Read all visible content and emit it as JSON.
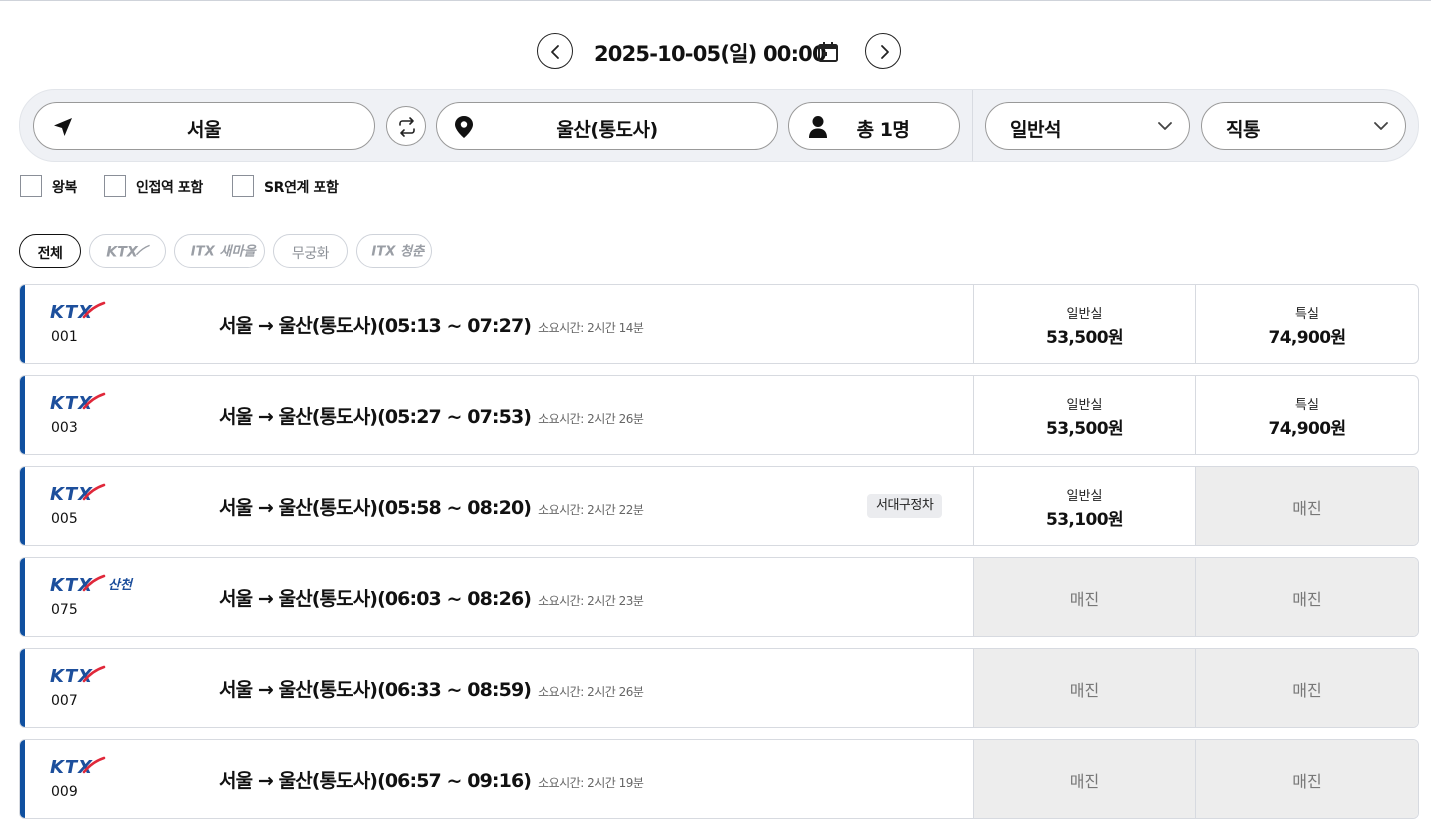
{
  "date_bar": {
    "date_text": "2025-10-05(일) 00:00"
  },
  "search": {
    "departure": "서울",
    "arrival": "울산(통도사)",
    "passengers": "총 1명",
    "seat_class": "일반석",
    "route_type": "직통"
  },
  "options": {
    "round_trip": "왕복",
    "include_nearby": "인접역 포함",
    "include_sr": "SR연계 포함"
  },
  "filters": {
    "all": "전체",
    "ktx": "KTX",
    "itx_saemaeul": "ITX 새마을",
    "mugunghwa": "무궁화",
    "itx_cheongchun": "ITX 청춘"
  },
  "labels": {
    "general": "일반실",
    "special": "특실",
    "sold_out": "매진"
  },
  "colors": {
    "accent": "#1050a0",
    "ktx_blue": "#1d4f9c",
    "ktx_red": "#e0283a",
    "sold_out_bg": "#ededed"
  },
  "trains": [
    {
      "logo": "KTX",
      "number": "001",
      "route": "서울 → 울산(통도사)(05:13 ~ 07:27)",
      "duration": "소요시간: 2시간 14분",
      "badge": "",
      "general": {
        "type": "일반실",
        "price": "53,500원"
      },
      "special": {
        "type": "특실",
        "price": "74,900원"
      }
    },
    {
      "logo": "KTX",
      "number": "003",
      "route": "서울 → 울산(통도사)(05:27 ~ 07:53)",
      "duration": "소요시간: 2시간 26분",
      "badge": "",
      "general": {
        "type": "일반실",
        "price": "53,500원"
      },
      "special": {
        "type": "특실",
        "price": "74,900원"
      }
    },
    {
      "logo": "KTX",
      "number": "005",
      "route": "서울 → 울산(통도사)(05:58 ~ 08:20)",
      "duration": "소요시간: 2시간 22분",
      "badge": "서대구정차",
      "general": {
        "type": "일반실",
        "price": "53,100원"
      },
      "special": {
        "sold_out": "매진"
      }
    },
    {
      "logo": "KTX-산천",
      "number": "075",
      "route": "서울 → 울산(통도사)(06:03 ~ 08:26)",
      "duration": "소요시간: 2시간 23분",
      "badge": "",
      "general": {
        "sold_out": "매진"
      },
      "special": {
        "sold_out": "매진"
      }
    },
    {
      "logo": "KTX",
      "number": "007",
      "route": "서울 → 울산(통도사)(06:33 ~ 08:59)",
      "duration": "소요시간: 2시간 26분",
      "badge": "",
      "general": {
        "sold_out": "매진"
      },
      "special": {
        "sold_out": "매진"
      }
    },
    {
      "logo": "KTX",
      "number": "009",
      "route": "서울 → 울산(통도사)(06:57 ~ 09:16)",
      "duration": "소요시간: 2시간 19분",
      "badge": "",
      "general": {
        "sold_out": "매진"
      },
      "special": {
        "sold_out": "매진"
      }
    }
  ]
}
